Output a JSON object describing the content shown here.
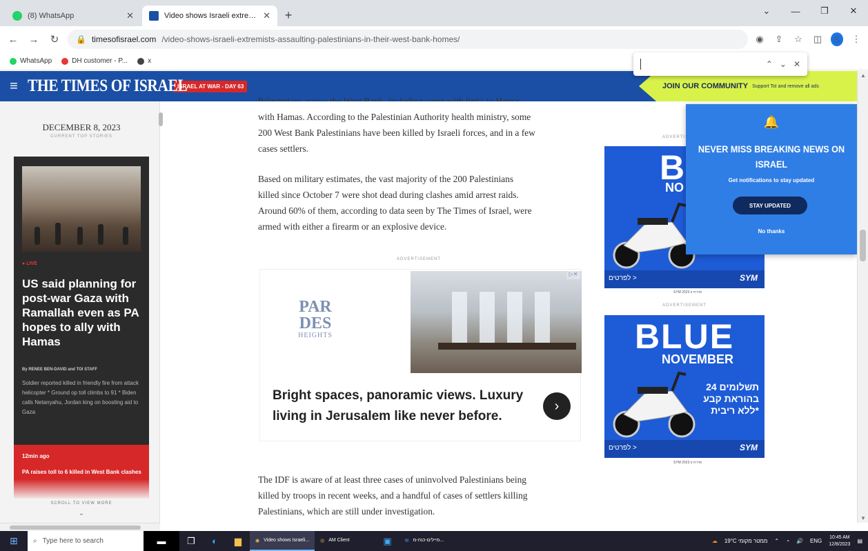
{
  "browser": {
    "tabs": [
      {
        "title": "(8) WhatsApp",
        "favicon_color": "#25d366"
      },
      {
        "title": "Video shows Israeli extremists a",
        "favicon_color": "#1b4fa5"
      }
    ],
    "new_tab": "+",
    "url_host": "timesofisrael.com",
    "url_path": "/video-shows-israeli-extremists-assaulting-palestinians-in-their-west-bank-homes/",
    "profile_initial": "S",
    "bookmarks": [
      {
        "label": "WhatsApp",
        "color": "#25d366"
      },
      {
        "label": "DH customer - P...",
        "color": "#e53935"
      },
      {
        "label": "x",
        "color": "#444"
      }
    ]
  },
  "findbar": {
    "query": ""
  },
  "site": {
    "logo": "THE TIMES OF ISRAEL",
    "war_badge": "ISRAEL AT WAR - DAY 63",
    "join": "JOIN OUR COMMUNITY",
    "join_sub": "Support ToI and remove all ads"
  },
  "sidebar": {
    "date": "DECEMBER 8, 2023",
    "sub": "CURRENT TOP STORIES",
    "live": "LIVE",
    "headline": "US said planning for post-war Gaza with Ramallah even as PA hopes to ally with Hamas",
    "byline": "By RENEE BEN-DAVID and TOI STAFF",
    "blurb": "Soldier reported killed in friendly fire from attack helicopter * Ground op toll climbs to 91 * Biden calls Netanyahu, Jordan king on boosting aid to Gaza",
    "red_time": "12min ago",
    "red_text": "PA raises toll to 6 killed in West Bank clashes",
    "scroll": "SCROLL TO VIEW MORE"
  },
  "article": {
    "p1_cut": "Palestinians across the West Bank, including some with links to Hamas,",
    "p1_lines": [
      "with Hamas. According to the Palestinian Authority health ministry, some",
      "200 West Bank Palestinians have been killed by Israeli forces, and in a few",
      "cases settlers."
    ],
    "p2_lines": [
      "Based on military estimates, the vast majority of the 200 Palestinians",
      "killed since October 7 were shot dead during clashes amid arrest raids.",
      "Around 60% of them, according to data seen by The Times of Israel, were",
      "armed with either a firearm or an explosive device."
    ],
    "ad_label": "ADVERTISEMENT",
    "ad_logo_a": "PAR",
    "ad_logo_b": "DES",
    "ad_logo_c": "HEIGHTS",
    "ad_text": "Bright spaces, panoramic views. Luxury living in Jerusalem like never before.",
    "p3_lines": [
      "The IDF is aware of at least three cases of uninvolved Palestinians being",
      "killed by troops in recent weeks, and a handful of cases of settlers killing",
      "Palestinians, which are still under investigation."
    ]
  },
  "right_ads": {
    "label": "ADVERTISEMENT",
    "ad1_big": "BL",
    "ad1_sub": "NO",
    "ad2_big": "BLUE",
    "ad2_sub": "NOVEMBER",
    "ad2_heb": "24 תשלומים בהוראת קבע ללא ריבית*",
    "brand": "SYM",
    "brand_left": "לפרטים >",
    "foot": "SYM 2023 סדרת זו"
  },
  "notif": {
    "bell": "🔔",
    "title": "NEVER MISS BREAKING NEWS ON ISRAEL",
    "sub": "Get notifications to stay updated",
    "button": "STAY UPDATED",
    "no": "No thanks"
  },
  "taskbar": {
    "search": "Type here to search",
    "app1": "Video shows Israeli...",
    "app2": "AM Client",
    "app3": "מיילים-כנה-מ...",
    "weather": "19°C ממטר מקומי",
    "lang": "ENG",
    "time": "10:45 AM",
    "date": "12/8/2023"
  },
  "colors": {
    "brand": "#1b4fa5",
    "war": "#d62828",
    "community": "#d9f24a",
    "notif": "#2f7ee6"
  }
}
